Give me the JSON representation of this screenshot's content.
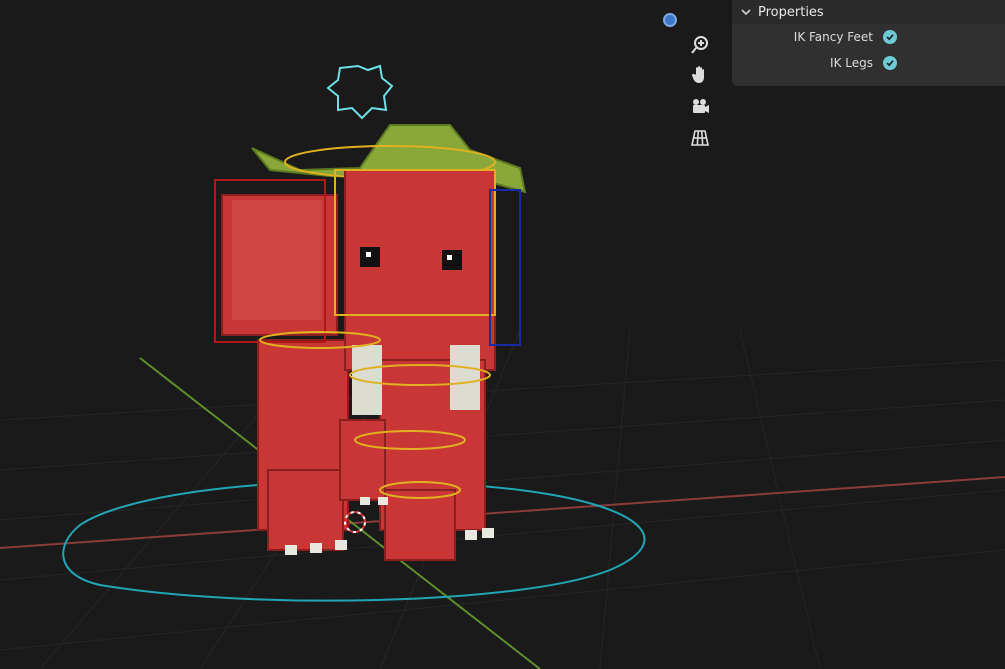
{
  "viewport": {
    "gizmo_icon": "view-gizmo-dot",
    "nav_tools": [
      {
        "name": "zoom-icon"
      },
      {
        "name": "pan-hand-icon"
      },
      {
        "name": "camera-icon"
      },
      {
        "name": "grid-view-icon"
      }
    ]
  },
  "properties_panel": {
    "title": "Properties",
    "items": [
      {
        "label": "IK Fancy Feet",
        "checked": true
      },
      {
        "label": "IK Legs",
        "checked": true
      }
    ]
  },
  "colors": {
    "background": "#1a1a1a",
    "grid": "#2a2a2a",
    "x_axis": "#8a3b3b",
    "y_axis": "#5f8f2a",
    "model": "#d03a3a",
    "bones": "#e0b020",
    "rings": "#22a6b3",
    "accent": "#6ecbd6"
  }
}
